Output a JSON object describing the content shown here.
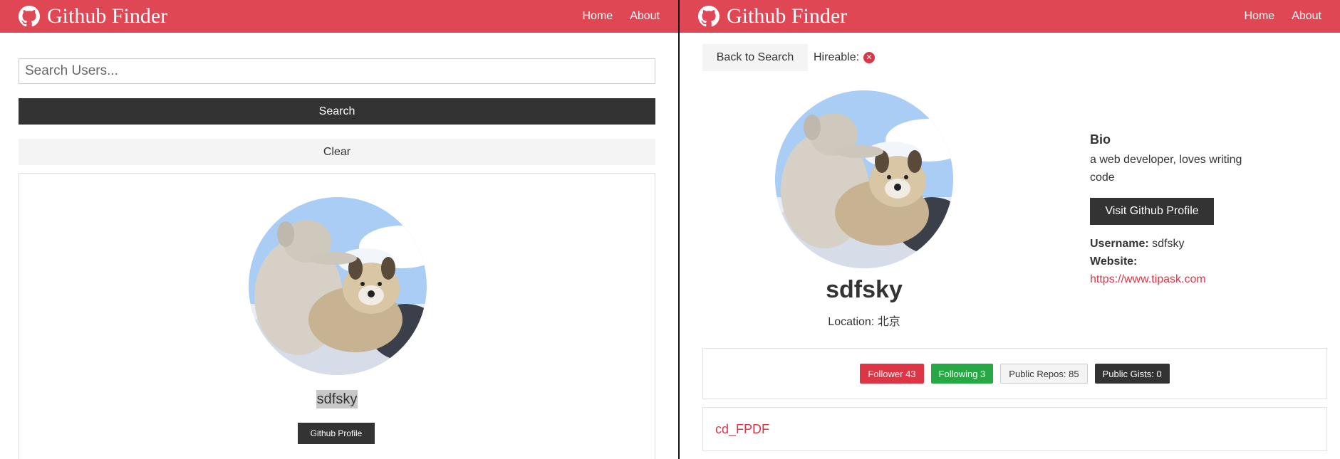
{
  "colors": {
    "brand": "#e04755",
    "dark": "#333333",
    "light": "#f4f4f4",
    "success": "#28a745",
    "danger": "#dc3545"
  },
  "navbar": {
    "brand_icon": "github-icon",
    "title": "Github Finder",
    "links": [
      "Home",
      "About"
    ]
  },
  "left": {
    "search": {
      "placeholder": "Search Users...",
      "value": ""
    },
    "search_label": "Search",
    "clear_label": "Clear",
    "user_card": {
      "login": "sdfsky",
      "profile_label": "Github Profile"
    }
  },
  "right": {
    "back_label": "Back to Search",
    "hireable_label": "Hireable:",
    "hireable_icon": "times-circle-icon",
    "profile": {
      "name": "sdfsky",
      "location_label": "Location:",
      "location": "北京"
    },
    "bio": {
      "heading": "Bio",
      "text": "a web developer, loves writing code"
    },
    "visit_label": "Visit Github Profile",
    "username_label": "Username:",
    "username": "sdfsky",
    "website_label": "Website:",
    "website": "https://www.tipask.com",
    "badges": {
      "followers": "Follower 43",
      "following": "Following 3",
      "repos": "Public Repos: 85",
      "gists": "Public Gists: 0"
    },
    "repos": [
      {
        "name": "cd_FPDF"
      }
    ]
  }
}
